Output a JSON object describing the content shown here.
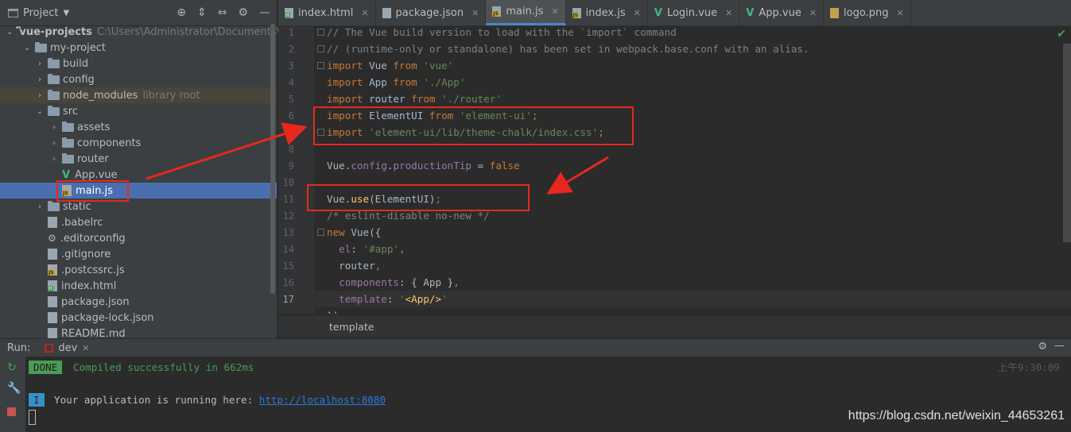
{
  "project_panel": {
    "title": "Project",
    "tree": [
      {
        "label": "vue-projects",
        "extra": "C:\\Users\\Administrator\\Documents\\vu",
        "type": "folder",
        "expanded": true
      },
      {
        "label": "my-project",
        "type": "folder",
        "expanded": true
      },
      {
        "label": "build",
        "type": "folder"
      },
      {
        "label": "config",
        "type": "folder"
      },
      {
        "label": "node_modules",
        "extra": "library root",
        "type": "folder"
      },
      {
        "label": "src",
        "type": "folder",
        "expanded": true
      },
      {
        "label": "assets",
        "type": "folder"
      },
      {
        "label": "components",
        "type": "folder"
      },
      {
        "label": "router",
        "type": "folder"
      },
      {
        "label": "App.vue",
        "type": "vue"
      },
      {
        "label": "main.js",
        "type": "js",
        "selected": true
      },
      {
        "label": "static",
        "type": "folder"
      },
      {
        "label": ".babelrc",
        "type": "file"
      },
      {
        "label": ".editorconfig",
        "type": "config"
      },
      {
        "label": ".gitignore",
        "type": "file"
      },
      {
        "label": ".postcssrc.js",
        "type": "js"
      },
      {
        "label": "index.html",
        "type": "html"
      },
      {
        "label": "package.json",
        "type": "file"
      },
      {
        "label": "package-lock.json",
        "type": "file"
      },
      {
        "label": "README.md",
        "type": "file"
      }
    ]
  },
  "tabs": [
    {
      "label": "index.html",
      "icon": "html-file-icon"
    },
    {
      "label": "package.json",
      "icon": "json-file-icon"
    },
    {
      "label": "main.js",
      "icon": "js-file-icon",
      "active": true
    },
    {
      "label": "index.js",
      "icon": "js-file-icon"
    },
    {
      "label": "Login.vue",
      "icon": "vue-file-icon"
    },
    {
      "label": "App.vue",
      "icon": "vue-file-icon"
    },
    {
      "label": "logo.png",
      "icon": "image-file-icon"
    }
  ],
  "editor": {
    "line_numbers": [
      "1",
      "2",
      "3",
      "4",
      "5",
      "6",
      "7",
      "8",
      "9",
      "10",
      "11",
      "12",
      "13",
      "14",
      "15",
      "16",
      "17"
    ],
    "current_line": "17",
    "lines": [
      [
        [
          "cm",
          "// The Vue build version to load with the `import` command"
        ]
      ],
      [
        [
          "cm",
          "// (runtime-only or standalone) has been set in webpack.base.conf with an alias."
        ]
      ],
      [
        [
          "kw",
          "import "
        ],
        [
          "",
          "Vue "
        ],
        [
          "kw",
          "from "
        ],
        [
          "str",
          "'vue'"
        ]
      ],
      [
        [
          "kw",
          "import "
        ],
        [
          "",
          "App "
        ],
        [
          "kw",
          "from "
        ],
        [
          "str",
          "'./App'"
        ]
      ],
      [
        [
          "kw",
          "import "
        ],
        [
          "",
          "router "
        ],
        [
          "kw",
          "from "
        ],
        [
          "str",
          "'./router'"
        ]
      ],
      [
        [
          "kw",
          "import "
        ],
        [
          "",
          "ElementUI "
        ],
        [
          "kw",
          "from "
        ],
        [
          "str",
          "'element-ui'"
        ],
        [
          "kw",
          ";"
        ]
      ],
      [
        [
          "kw",
          "import "
        ],
        [
          "str",
          "'element-ui/lib/theme-chalk/index.css'"
        ],
        [
          "kw",
          ";"
        ]
      ],
      [],
      [
        [
          "",
          "Vue."
        ],
        [
          "prop",
          "config"
        ],
        [
          "",
          "."
        ],
        [
          "prop",
          "productionTip"
        ],
        [
          "",
          " = "
        ],
        [
          "kw",
          "false"
        ]
      ],
      [],
      [
        [
          "",
          "Vue."
        ],
        [
          "fn",
          "use"
        ],
        [
          "",
          "(ElementUI)"
        ],
        [
          "kw",
          ";"
        ]
      ],
      [
        [
          "cm",
          "/* eslint-disable no-new */"
        ]
      ],
      [
        [
          "kw",
          "new "
        ],
        [
          "",
          "Vue({"
        ]
      ],
      [
        [
          "prop",
          "  el"
        ],
        [
          "",
          ": "
        ],
        [
          "str",
          "'#app'"
        ],
        [
          "kw",
          ","
        ]
      ],
      [
        [
          "",
          "  router"
        ],
        [
          "kw",
          ","
        ]
      ],
      [
        [
          "prop",
          "  components"
        ],
        [
          "",
          ": { App }"
        ],
        [
          "kw",
          ","
        ]
      ],
      [
        [
          "prop",
          "  template"
        ],
        [
          "",
          ": "
        ],
        [
          "str",
          "'"
        ],
        [
          "fn",
          "<App/>"
        ],
        [
          "str",
          "'"
        ]
      ],
      [
        [
          "",
          "})"
        ]
      ]
    ],
    "breadcrumb": "template"
  },
  "run_panel": {
    "label": "Run:",
    "tab": "dev",
    "done_badge": "DONE",
    "done_text": "Compiled successfully in 662ms",
    "timestamp": "上午9:30:09",
    "info_badge": "I",
    "info_text": "Your application is running here: ",
    "info_link": "http://localhost:8080"
  },
  "watermark": "https://blog.csdn.net/weixin_44653261",
  "colors": {
    "annotation_red": "#e8281e",
    "selection_blue": "#4b6eaf",
    "keyword": "#cc7832",
    "string": "#6a8759",
    "comment": "#808080"
  }
}
